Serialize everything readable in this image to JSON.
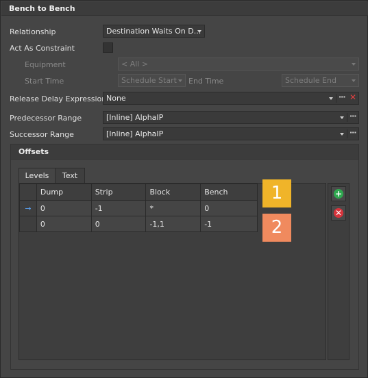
{
  "window": {
    "title": "Bench to Bench"
  },
  "form": {
    "relationship": {
      "label": "Relationship",
      "value": "Destination Waits On D..."
    },
    "act_as_constraint": {
      "label": "Act As Constraint",
      "checked": false
    },
    "equipment": {
      "label": "Equipment",
      "value": "< All >"
    },
    "start_time": {
      "label": "Start Time",
      "value": "Schedule Start"
    },
    "end_time": {
      "label": "End Time",
      "value": "Schedule End"
    },
    "release_delay": {
      "label": "Release Delay Expression",
      "value": "None"
    },
    "predecessor_range": {
      "label": "Predecessor Range",
      "value": "[Inline] AlphaIP"
    },
    "successor_range": {
      "label": "Successor Range",
      "value": "[Inline] AlphaIP"
    },
    "ellipsis": "···",
    "clear": "✕"
  },
  "offsets": {
    "title": "Offsets",
    "tabs": [
      {
        "label": "Levels",
        "active": true
      },
      {
        "label": "Text",
        "active": false
      }
    ],
    "columns": [
      "Dump",
      "Strip",
      "Block",
      "Bench"
    ],
    "rows": [
      {
        "current": true,
        "cells": [
          "0",
          "-1",
          "*",
          "0"
        ]
      },
      {
        "current": false,
        "cells": [
          "0",
          "0",
          "-1,1",
          "-1"
        ]
      }
    ],
    "row_indicator": "→",
    "badges": [
      {
        "label": "1",
        "color": "#f0b429"
      },
      {
        "label": "2",
        "color": "#f08a5e"
      }
    ],
    "add_symbol": "+",
    "remove_symbol": "✕",
    "add_color": "#2fa84f",
    "remove_color": "#d8343c"
  }
}
